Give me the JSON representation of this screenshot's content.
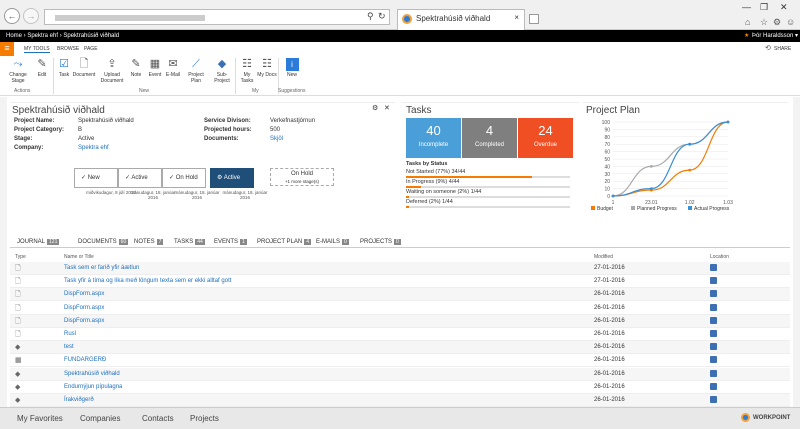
{
  "browser": {
    "tab_title": "Spektrahúsið viðhald",
    "tab_close": "×",
    "window_controls": [
      "—",
      "❐",
      "✕"
    ],
    "toolbar_icons": [
      "home-icon",
      "star-icon",
      "settings-icon",
      "smiley-icon"
    ]
  },
  "suite_bar": {
    "breadcrumb": "Home › Spektra ehf › Spektrahúsið viðhald",
    "user": "Þór Haraldsson ▾",
    "star": "★"
  },
  "ribbon": {
    "tabs": [
      "MY TOOLS",
      "BROWSE",
      "PAGE"
    ],
    "share": "SHARE",
    "buttons": {
      "change_stage": "Change Stage",
      "edit": "Edit",
      "task": "Task",
      "document": "Document",
      "upload_document": "Upload Document",
      "note": "Note",
      "event": "Event",
      "email": "E-Mail",
      "project_plan": "Project Plan",
      "sub_project": "Sub-Project",
      "my_tasks": "My Tasks",
      "my_docs": "My Docs",
      "new": "New"
    },
    "groups": {
      "actions": "Actions",
      "new": "New",
      "my": "My",
      "suggestions": "Suggestions"
    }
  },
  "project": {
    "title": "Spektrahúsið viðhald",
    "fields": {
      "project_name_label": "Project Name:",
      "project_name": "Spektrahúsið viðhald",
      "project_category_label": "Project Category:",
      "project_category": "B",
      "stage_label": "Stage:",
      "stage": "Active",
      "company_label": "Company:",
      "company": "Spektra ehf",
      "service_division_label": "Service Divison:",
      "service_division": "Verkefnastjórnun",
      "projected_hours_label": "Projected hours:",
      "projected_hours": "500",
      "documents_label": "Documents:",
      "documents": "Skjöl"
    },
    "stages": [
      {
        "label": "New",
        "date": "miðvikudagur, 8 júlí 2015"
      },
      {
        "label": "Active",
        "date": "mánudagur, 18. janúar 2016"
      },
      {
        "label": "On Hold",
        "date": "mánudagur, 18. janúar 2016"
      },
      {
        "label": "Active",
        "date": "mánudagur, 18. janúar 2016"
      },
      {
        "label": "On Hold",
        "date": "+1 more stage(s)"
      }
    ]
  },
  "tasks": {
    "title": "Tasks",
    "tiles": [
      {
        "count": "40",
        "label": "Incomplete",
        "color": "#4a9fd8"
      },
      {
        "count": "4",
        "label": "Completed",
        "color": "#7f7f7f"
      },
      {
        "count": "24",
        "label": "Overdue",
        "color": "#f04e23"
      }
    ],
    "by_status_title": "Tasks by Status",
    "statuses": [
      {
        "label": "Not Started (77%) 34/44",
        "pct": 0.77
      },
      {
        "label": "In Progress (9%) 4/44",
        "pct": 0.09
      },
      {
        "label": "Waiting on someone (2%) 1/44",
        "pct": 0.02
      },
      {
        "label": "Deferred (2%) 1/44",
        "pct": 0.02
      }
    ]
  },
  "chart_data": {
    "type": "line",
    "title": "Project Plan",
    "x": [
      "1",
      "23.01",
      "1.02",
      "1.03"
    ],
    "ylim": [
      0,
      100
    ],
    "yticks": [
      0,
      10,
      20,
      30,
      40,
      50,
      60,
      70,
      80,
      90,
      100
    ],
    "series": [
      {
        "name": "Budget",
        "color": "#f57c00",
        "values": [
          0,
          8,
          35,
          100
        ]
      },
      {
        "name": "Planned Progress",
        "color": "#aaaaaa",
        "values": [
          0,
          40,
          70,
          100
        ]
      },
      {
        "name": "Actual Progress",
        "color": "#3a8fd6",
        "values": [
          0,
          10,
          70,
          100
        ]
      }
    ]
  },
  "journal": {
    "tabs": [
      {
        "label": "JOURNAL",
        "count": "121"
      },
      {
        "label": "DOCUMENTS",
        "count": "60"
      },
      {
        "label": "NOTES",
        "count": "7"
      },
      {
        "label": "TASKS",
        "count": "44"
      },
      {
        "label": "EVENTS",
        "count": "1"
      },
      {
        "label": "PROJECT PLAN",
        "count": "4"
      },
      {
        "label": "E-MAILS",
        "count": "0"
      },
      {
        "label": "PROJECTS",
        "count": "0"
      }
    ],
    "headers": {
      "type": "Type",
      "title": "Name or Title",
      "modified": "Modified",
      "location": "Location"
    },
    "rows": [
      {
        "icon": "🗋",
        "title": "Task sem er farið yfir áætlun",
        "modified": "27-01-2016"
      },
      {
        "icon": "🗋",
        "title": "Task yfir á tíma og líka með löngum texta sem er ekki alltaf gott",
        "modified": "27-01-2016"
      },
      {
        "icon": "🗋",
        "title": "DispForm.aspx",
        "modified": "26-01-2016"
      },
      {
        "icon": "🗋",
        "title": "DispForm.aspx",
        "modified": "26-01-2016"
      },
      {
        "icon": "🗋",
        "title": "DispForm.aspx",
        "modified": "26-01-2016"
      },
      {
        "icon": "🗋",
        "title": "Rusl",
        "modified": "26-01-2016"
      },
      {
        "icon": "◆",
        "title": "test",
        "modified": "26-01-2016"
      },
      {
        "icon": "▦",
        "title": "FUNDARGERÐ",
        "modified": "26-01-2016"
      },
      {
        "icon": "◆",
        "title": "Spektrahúsið viðhald",
        "modified": "26-01-2016"
      },
      {
        "icon": "◆",
        "title": "Endurnýjun pípulagna",
        "modified": "26-01-2016"
      },
      {
        "icon": "◆",
        "title": "Írakviðgerð",
        "modified": "26-01-2016"
      }
    ]
  },
  "footer": {
    "nav": [
      "My Favorites",
      "Companies",
      "Contacts",
      "Projects"
    ],
    "brand": "WORKPOINT"
  }
}
